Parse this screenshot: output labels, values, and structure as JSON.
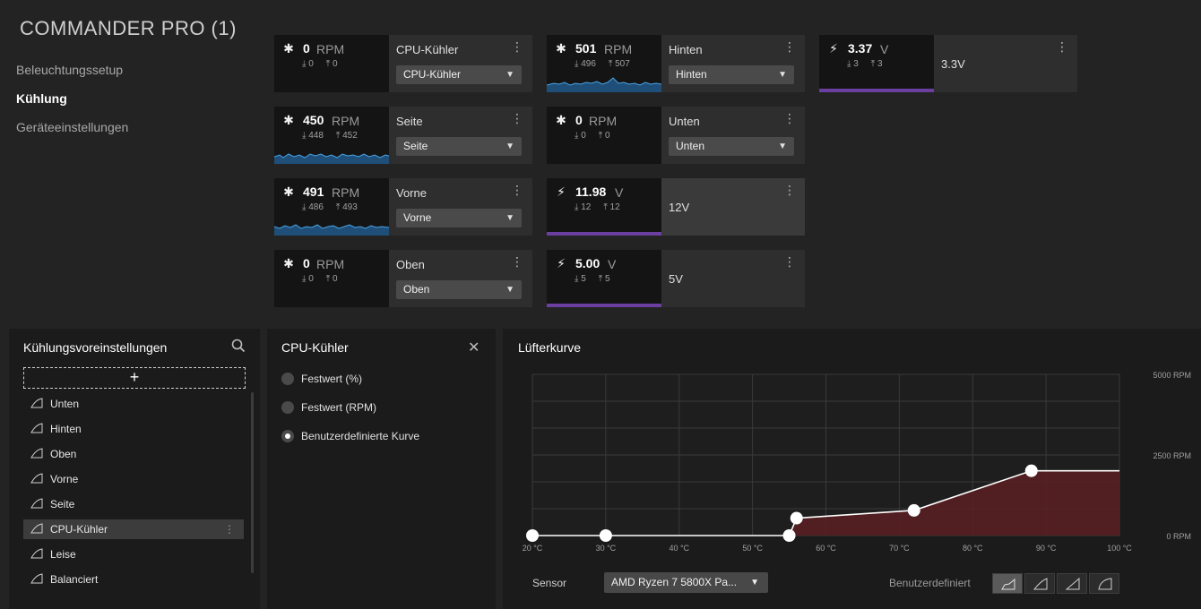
{
  "device": {
    "title": "COMMANDER PRO (1)"
  },
  "nav": {
    "items": [
      {
        "label": "Beleuchtungssetup"
      },
      {
        "label": "Kühlung"
      },
      {
        "label": "Geräteeinstellungen"
      }
    ],
    "active_index": 1
  },
  "fans": [
    {
      "reading": "0",
      "unit": "RPM",
      "min": "0",
      "max": "0",
      "name": "CPU-Kühler",
      "select": "CPU-Kühler"
    },
    {
      "reading": "450",
      "unit": "RPM",
      "min": "448",
      "max": "452",
      "name": "Seite",
      "select": "Seite"
    },
    {
      "reading": "491",
      "unit": "RPM",
      "min": "486",
      "max": "493",
      "name": "Vorne",
      "select": "Vorne"
    },
    {
      "reading": "0",
      "unit": "RPM",
      "min": "0",
      "max": "0",
      "name": "Oben",
      "select": "Oben"
    },
    {
      "reading": "501",
      "unit": "RPM",
      "min": "496",
      "max": "507",
      "name": "Hinten",
      "select": "Hinten"
    },
    {
      "reading": "0",
      "unit": "RPM",
      "min": "0",
      "max": "0",
      "name": "Unten",
      "select": "Unten"
    }
  ],
  "voltages": [
    {
      "reading": "11.98",
      "unit": "V",
      "min": "12",
      "max": "12",
      "name": "12V"
    },
    {
      "reading": "5.00",
      "unit": "V",
      "min": "5",
      "max": "5",
      "name": "5V"
    },
    {
      "reading": "3.37",
      "unit": "V",
      "min": "3",
      "max": "3",
      "name": "3.3V"
    }
  ],
  "presets_panel": {
    "title": "Kühlungsvoreinstellungen",
    "add_label": "+",
    "items": [
      "Unten",
      "Hinten",
      "Oben",
      "Vorne",
      "Seite",
      "CPU-Kühler",
      "Leise",
      "Balanciert"
    ],
    "selected": "CPU-Kühler"
  },
  "mode_panel": {
    "title": "CPU-Kühler",
    "close": "✕",
    "options": [
      "Festwert (%)",
      "Festwert (RPM)",
      "Benutzerdefinierte Kurve"
    ],
    "selected_index": 2
  },
  "curve_panel": {
    "title": "Lüfterkurve",
    "sensor_label": "Sensor",
    "sensor_value": "AMD Ryzen 7 5800X Pa...",
    "mode_label": "Benutzerdefiniert",
    "colors": {
      "fill": "#5a1f22",
      "line": "#ffffff",
      "grid": "#3a3a3a"
    }
  },
  "chart_data": {
    "type": "line",
    "x_ticks": [
      "20 °C",
      "30 °C",
      "40 °C",
      "50 °C",
      "60 °C",
      "70 °C",
      "80 °C",
      "90 °C",
      "100 °C"
    ],
    "y_ticks": [
      "5000 RPM",
      "2500 RPM",
      "0 RPM"
    ],
    "xlim": [
      20,
      100
    ],
    "ylim": [
      0,
      5000
    ],
    "points": [
      [
        20,
        0
      ],
      [
        30,
        0
      ],
      [
        55,
        0
      ],
      [
        56,
        540
      ],
      [
        72,
        780
      ],
      [
        88,
        2010
      ],
      [
        100,
        2010
      ]
    ],
    "handles": [
      [
        20,
        0
      ],
      [
        30,
        0
      ],
      [
        55,
        0
      ],
      [
        56,
        540
      ],
      [
        72,
        780
      ],
      [
        88,
        2010
      ]
    ]
  }
}
